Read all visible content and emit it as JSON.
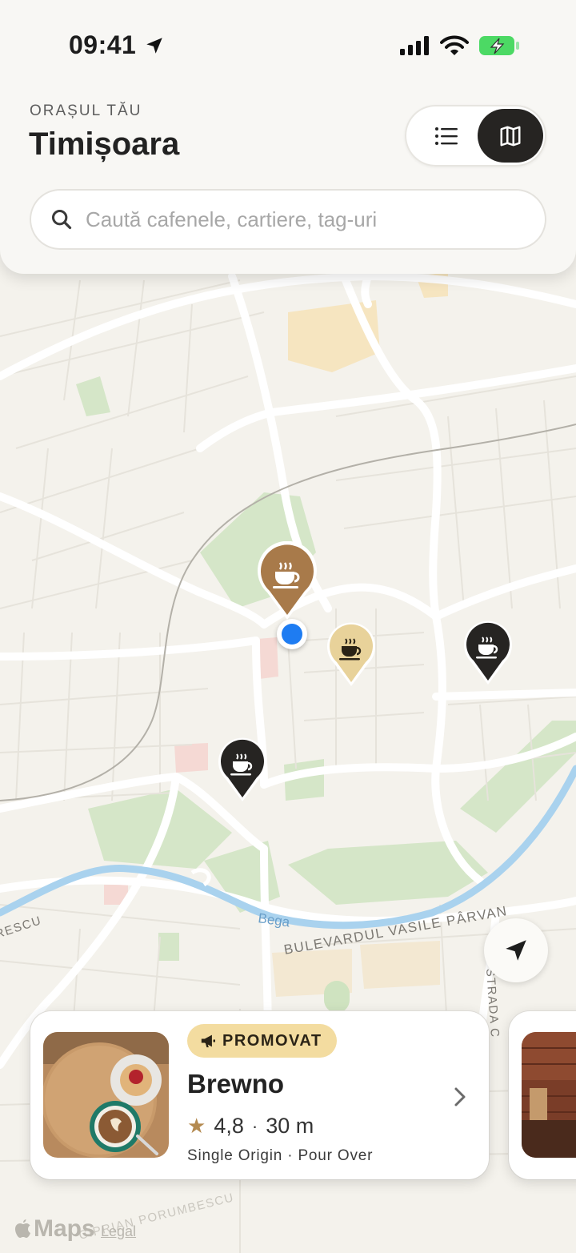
{
  "status_bar": {
    "time": "09:41"
  },
  "header": {
    "eyebrow": "ORAȘUL TĂU",
    "city": "Timișoara",
    "view_toggle": {
      "options": [
        "list",
        "map"
      ],
      "selected": "map"
    }
  },
  "search": {
    "placeholder": "Caută cafenele, cartiere, tag-uri",
    "value": ""
  },
  "map": {
    "labels": {
      "river": "Bega",
      "boulevard": "BULEVARDUL VASILE PÂRVAN",
      "street_right": "STRADA C",
      "street_left": "RESCU",
      "street_bottom": "CIPRIAN PORUMBESCU"
    },
    "pins": [
      {
        "name": "cafe-pin-brown",
        "color": "#a87a4a",
        "style": "large"
      },
      {
        "name": "cafe-pin-gold",
        "color": "#e8d29a",
        "style": "medium"
      },
      {
        "name": "cafe-pin-dark-east",
        "color": "#262422",
        "style": "medium"
      },
      {
        "name": "cafe-pin-dark-southwest",
        "color": "#262422",
        "style": "medium"
      }
    ],
    "attribution": {
      "logo": "Maps",
      "legal": "Legal"
    }
  },
  "card": {
    "badge": "PROMOVAT",
    "name": "Brewno",
    "rating": "4,8",
    "separator": "·",
    "distance": "30 m",
    "tags": "Single Origin · Pour Over"
  },
  "colors": {
    "accent_dark": "#262422",
    "badge_bg": "#f3dca0",
    "user_dot": "#1e7cf2",
    "star": "#b48a50",
    "river": "#a9d2ee",
    "park": "#d5e6c8"
  }
}
